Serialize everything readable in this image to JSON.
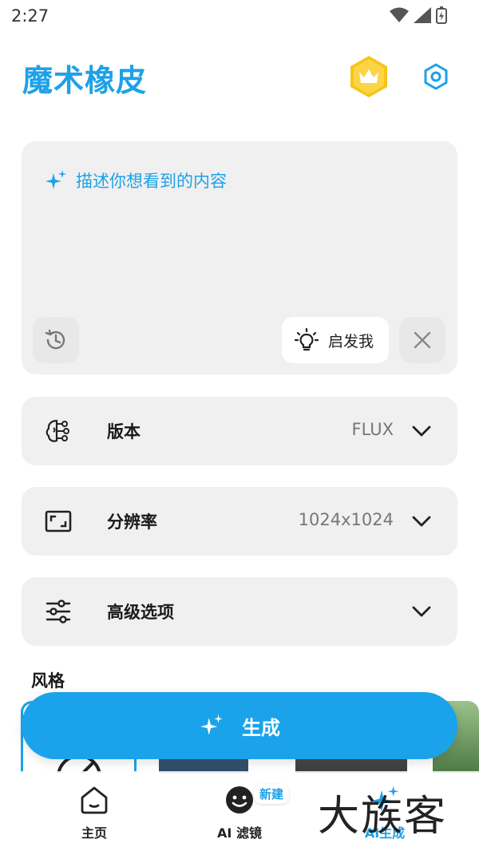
{
  "status_bar": {
    "time": "2:27"
  },
  "header": {
    "title": "魔术橡皮"
  },
  "prompt": {
    "placeholder": "描述你想看到的内容",
    "inspire_label": "启发我"
  },
  "options": [
    {
      "label": "版本",
      "value": "FLUX",
      "icon": "brain-icon"
    },
    {
      "label": "分辨率",
      "value": "1024x1024",
      "icon": "aspect-ratio-icon"
    },
    {
      "label": "高级选项",
      "value": "",
      "icon": "sliders-icon"
    }
  ],
  "style_section": {
    "title": "风格"
  },
  "generate": {
    "label": "生成"
  },
  "bottom_nav": {
    "items": [
      {
        "label": "主页",
        "icon": "home-icon"
      },
      {
        "label": "AI 滤镜",
        "icon": "face-filter-icon",
        "badge": "新建"
      },
      {
        "label": "AI生成",
        "icon": "sparkle-icon",
        "active": true
      }
    ]
  },
  "watermark": "大族客",
  "colors": {
    "accent": "#1da1e8",
    "card": "#f0f0f0",
    "badge_gold": "#f5c518"
  }
}
